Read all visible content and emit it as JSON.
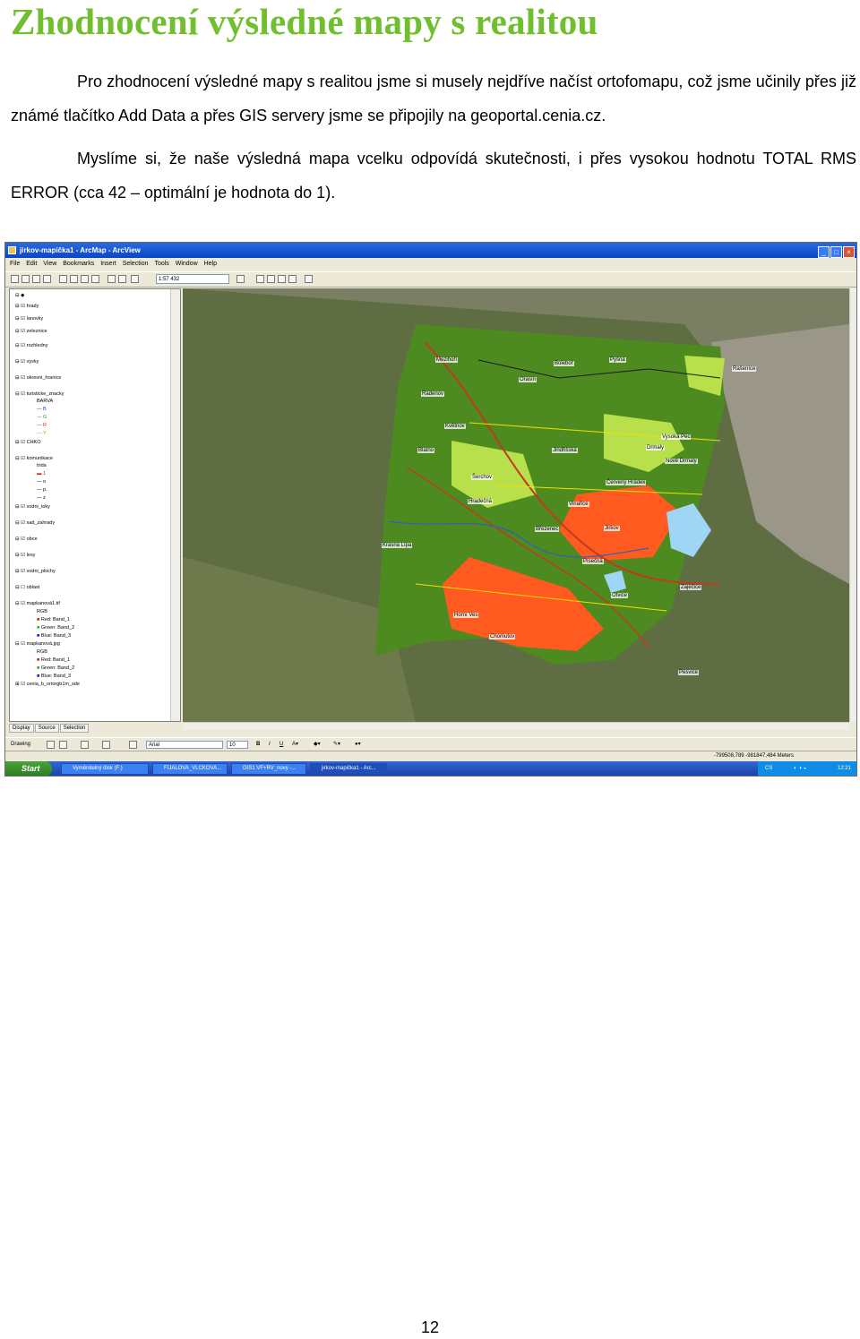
{
  "heading": "Zhodnocení výsledné mapy s realitou",
  "paragraph1": "Pro zhodnocení výsledné mapy s realitou jsme si musely nejdříve načíst ortofomapu, což jsme učinily přes již známé tlačítko Add Data a přes GIS servery jsme se připojily na geoportal.cenia.cz.",
  "paragraph2": "Myslíme si, že naše výsledná mapa vcelku odpovídá skutečnosti, i přes vysokou hodnotu TOTAL RMS ERROR (cca 42 – optimální je hodnota do 1).",
  "page_number": "12",
  "screenshot": {
    "window_title": "jirkov-mapička1 - ArcMap - ArcView",
    "menu": [
      "File",
      "Edit",
      "View",
      "Bookmarks",
      "Insert",
      "Selection",
      "Tools",
      "Window",
      "Help"
    ],
    "scale": "1:57 432",
    "toc_items": [
      "hrady",
      "lanovky",
      "zeleznice",
      "rozhledny",
      "vysky",
      "okresni_hranice",
      "turisticke_znacky",
      "BARVA",
      "B",
      "G",
      "R",
      "Y",
      "CHKO",
      "komunikace",
      "trida",
      "1",
      "o",
      "p.",
      "z",
      "vodni_toky",
      "sad_zahrady",
      "obce",
      "lesy",
      "vodni_plochy",
      "oblast",
      "mapkanová1.tif",
      "RGB",
      "Red:   Band_1",
      "Green: Band_2",
      "Blue:   Band_3",
      "mapkanová.jpg",
      "RGB",
      "Red:   Band_1",
      "Green: Band_2",
      "Blue:   Band_3",
      "cenia_b_ortorgb1m_sde"
    ],
    "toc_tabs": [
      "Display",
      "Source",
      "Selection"
    ],
    "drawing_label": "Drawing",
    "font_name": "Arial",
    "font_size": "10",
    "status_coords": "-799508,789  -981847,484 Meters",
    "taskbar": {
      "start": "Start",
      "tasks": [
        "Vyměnitelný disk (F:)",
        "FIJALOVA_VLCKOVA...",
        "GIS1 VF+RV_novy -...",
        "jirkov-mapička1 - Arc..."
      ],
      "lang": "CS",
      "clock": "12:21"
    },
    "map_labels": [
      "Mezihoří",
      "Boleboř",
      "Pyšná",
      "Orasín",
      "Rašeníce",
      "Radenov",
      "Květnov",
      "Blatno",
      "Jindřišská",
      "Drmaly",
      "Vysoká Pec",
      "Nové Drmaly",
      "Červený Hrádek",
      "Šerchov",
      "Hradečná",
      "Vinařice",
      "Březenec",
      "Jirkov",
      "Krásná Lípa",
      "Písečná",
      "Otvice",
      "Zaječice",
      "Horní Ves",
      "Chomutov",
      "Pesvice"
    ],
    "legend_colors": {
      "forest": "#4d8a1f",
      "urban": "#ff5a1f",
      "meadow": "#b8e04a",
      "water": "#9fd6f5",
      "road": "#c23b1c"
    }
  }
}
